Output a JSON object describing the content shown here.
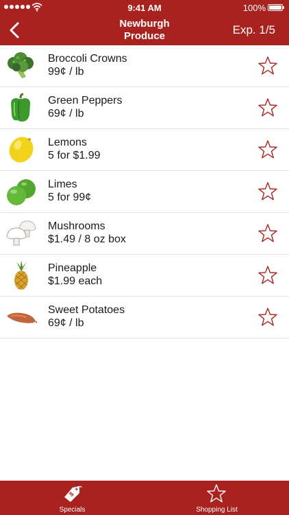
{
  "status_bar": {
    "time": "9:41 AM",
    "battery": "100%"
  },
  "header": {
    "title_line1": "Newburgh",
    "title_line2": "Produce",
    "expiry": "Exp. 1/5"
  },
  "items": [
    {
      "name": "Broccoli Crowns",
      "price": "99¢ / lb",
      "image": "broccoli"
    },
    {
      "name": "Green Peppers",
      "price": "69¢ / lb",
      "image": "green-pepper"
    },
    {
      "name": "Lemons",
      "price": "5 for $1.99",
      "image": "lemon"
    },
    {
      "name": "Limes",
      "price": "5 for 99¢",
      "image": "limes"
    },
    {
      "name": "Mushrooms",
      "price": "$1.49 / 8 oz box",
      "image": "mushrooms"
    },
    {
      "name": "Pineapple",
      "price": "$1.99 each",
      "image": "pineapple"
    },
    {
      "name": "Sweet Potatoes",
      "price": "69¢ / lb",
      "image": "sweet-potato"
    }
  ],
  "tabs": [
    {
      "label": "Specials",
      "icon": "price-tag-icon"
    },
    {
      "label": "Shopping List",
      "icon": "star-icon"
    }
  ],
  "colors": {
    "brand": "#a8221f",
    "star_outline": "#a8221f"
  }
}
